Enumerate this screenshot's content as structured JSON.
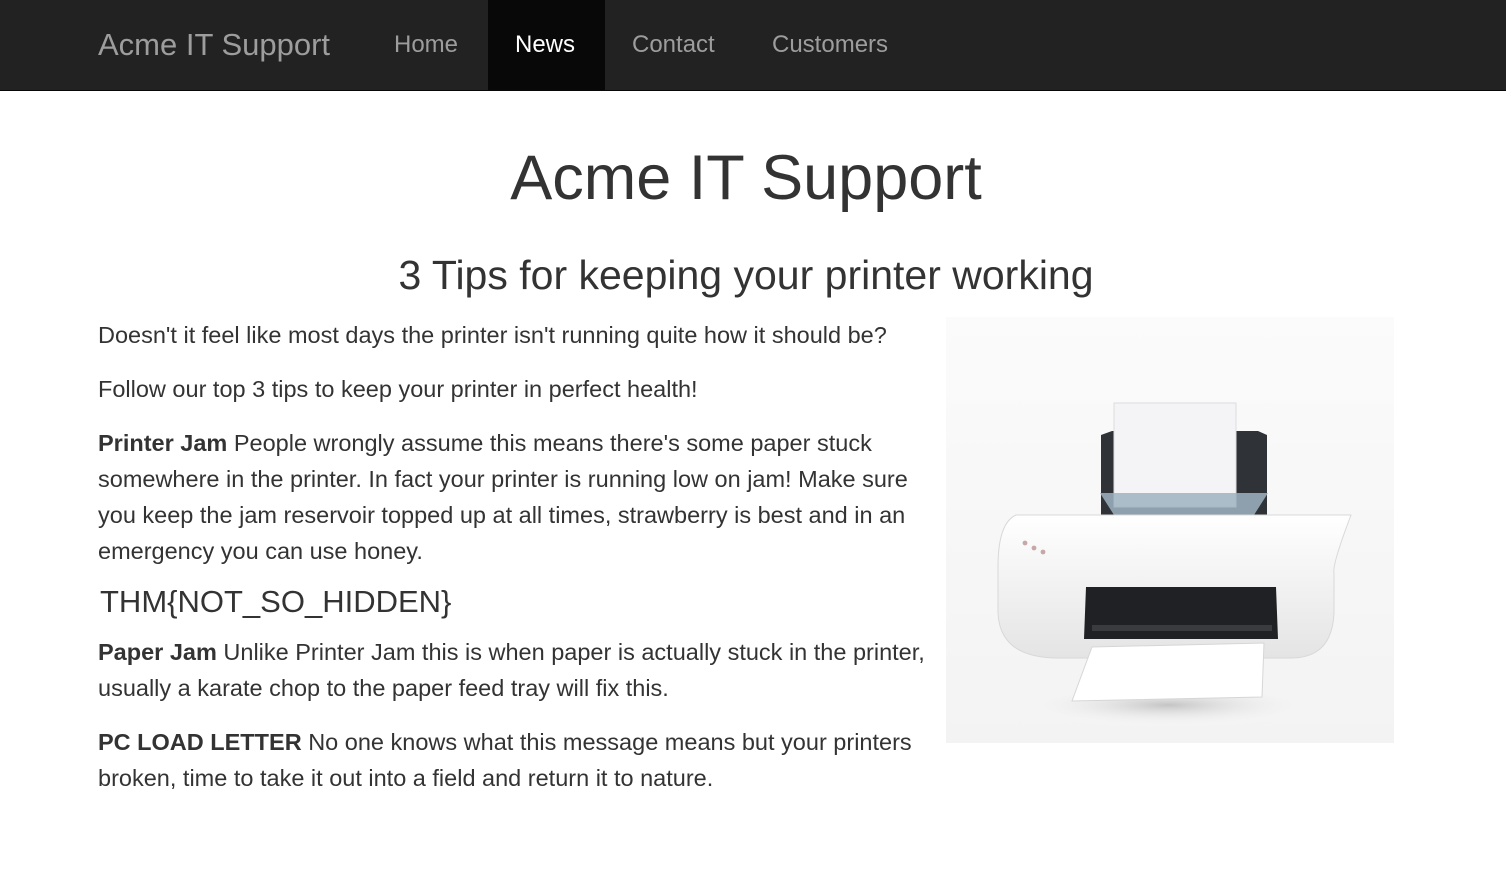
{
  "navbar": {
    "brand": "Acme IT Support",
    "links": [
      {
        "label": "Home",
        "active": false
      },
      {
        "label": "News",
        "active": true
      },
      {
        "label": "Contact",
        "active": false
      },
      {
        "label": "Customers",
        "active": false
      }
    ]
  },
  "page": {
    "site_title": "Acme IT Support",
    "article_title": "3 Tips for keeping your printer working",
    "intro_1": "Doesn't it feel like most days the printer isn't running quite how it should be?",
    "intro_2": "Follow our top 3 tips to keep your printer in perfect health!",
    "tips": [
      {
        "title": "Printer Jam",
        "text": " People wrongly assume this means there's some paper stuck somewhere in the printer. In fact your printer is running low on jam! Make sure you keep the jam reservoir topped up at all times, strawberry is best and in an emergency you can use honey."
      },
      {
        "title": "Paper Jam",
        "text": " Unlike Printer Jam this is when paper is actually stuck in the printer, usually a karate chop to the paper feed tray will fix this."
      },
      {
        "title": "PC LOAD LETTER",
        "text": " No one knows what this message means but your printers broken, time to take it out into a field and return it to nature."
      }
    ],
    "flag": "THM{NOT_SO_HIDDEN}"
  },
  "colors": {
    "navbar_bg": "#222222",
    "nav_active_bg": "#080808",
    "nav_text": "#9d9d9d",
    "body_text": "#333333"
  }
}
